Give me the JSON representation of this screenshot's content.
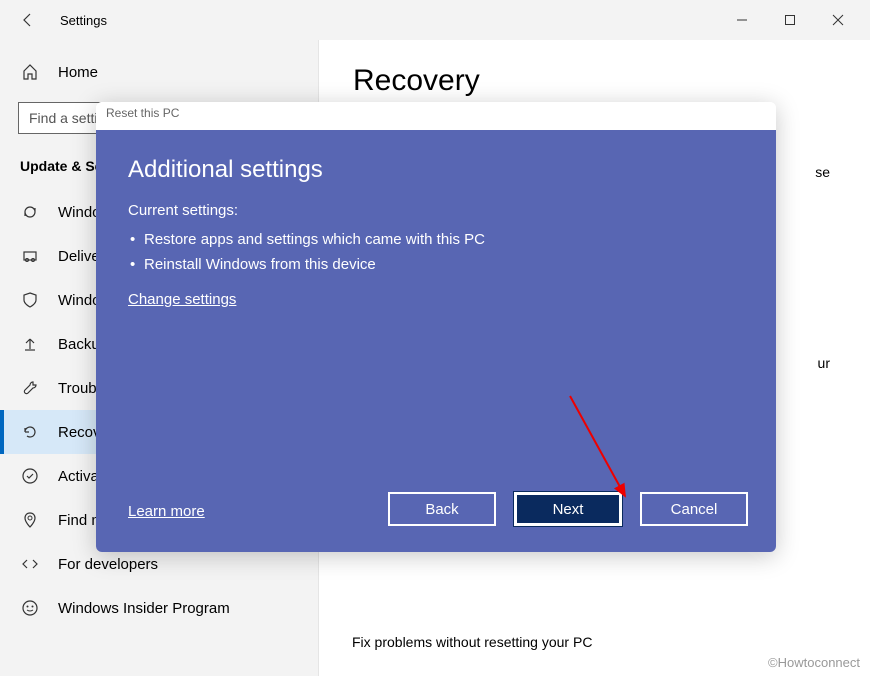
{
  "window": {
    "title": "Settings"
  },
  "sidebar": {
    "home_label": "Home",
    "search_placeholder": "Find a setting",
    "section_label": "Update & Security",
    "items": [
      {
        "label": "Windows Update"
      },
      {
        "label": "Delivery Optimization"
      },
      {
        "label": "Windows Security"
      },
      {
        "label": "Backup"
      },
      {
        "label": "Troubleshoot"
      },
      {
        "label": "Recovery"
      },
      {
        "label": "Activation"
      },
      {
        "label": "Find my device"
      },
      {
        "label": "For developers"
      },
      {
        "label": "Windows Insider Program"
      }
    ]
  },
  "main": {
    "title": "Recovery",
    "truncated_text_1": "se",
    "truncated_text_2": "ur",
    "bottom_text": "Fix problems without resetting your PC"
  },
  "dialog": {
    "titlebar": "Reset this PC",
    "heading": "Additional settings",
    "subheading": "Current settings:",
    "bullets": [
      "Restore apps and settings which came with this PC",
      "Reinstall Windows from this device"
    ],
    "change_link": "Change settings",
    "learn_more": "Learn more",
    "buttons": {
      "back": "Back",
      "next": "Next",
      "cancel": "Cancel"
    }
  },
  "watermark": "©Howtoconnect"
}
